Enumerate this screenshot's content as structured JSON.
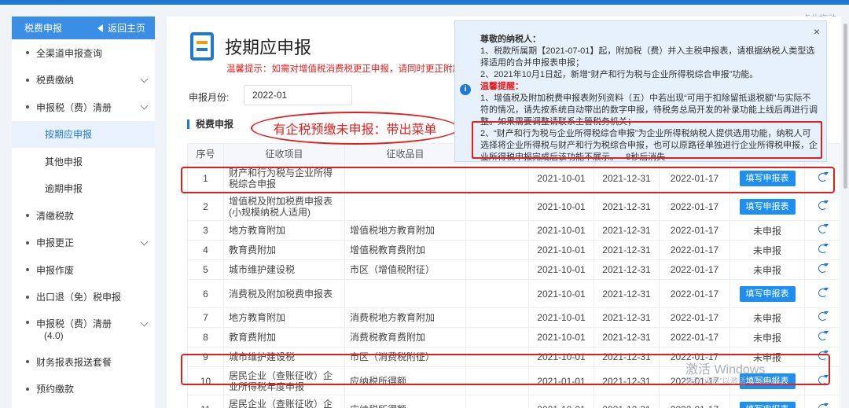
{
  "sidebar": {
    "title": "税费申报",
    "back_label": "返回主页",
    "items": [
      {
        "label": "全渠道申报查询",
        "expandable": false
      },
      {
        "label": "税费缴纳",
        "expandable": true
      },
      {
        "label": "申报税（费）清册",
        "expandable": true
      },
      {
        "label": "按期应申报",
        "sub": true,
        "active": true
      },
      {
        "label": "其他申报",
        "sub": true
      },
      {
        "label": "逾期申报",
        "sub": true
      },
      {
        "label": "清缴税款",
        "expandable": false
      },
      {
        "label": "申报更正",
        "expandable": true
      },
      {
        "label": "申报作废",
        "expandable": false
      },
      {
        "label": "出口退（免）税申报",
        "expandable": false
      },
      {
        "label": "申报税（费）清册",
        "label2": "(4.0)",
        "expandable": true
      },
      {
        "label": "财务报表报送套餐",
        "expandable": false
      },
      {
        "label": "预约缴款",
        "expandable": false
      }
    ]
  },
  "main": {
    "title": "按期应申报",
    "warm_tip": "温馨提示：如需对增值税消费税更正申报，请同时更正附加",
    "month_label": "申报月份:",
    "month_value": "2022-01",
    "section_label": "税费申报",
    "annotation": "有企税预缴未申报：带出菜单"
  },
  "table": {
    "headers": [
      "序号",
      "征收项目",
      "征收品目",
      "",
      "",
      "",
      "",
      "",
      ""
    ],
    "fill_label": "填写申报表",
    "unfiled_label": "未申报",
    "rows": [
      {
        "no": "1",
        "item": "财产和行为税与企业所得税综合申报",
        "sub": "",
        "start": "2021-10-01",
        "end": "2021-12-31",
        "due": "2022-01-17",
        "status": "fill",
        "tall": true
      },
      {
        "no": "2",
        "item": "增值税及附加税费申报表(小规模纳税人适用)",
        "sub": "",
        "start": "2021-10-01",
        "end": "2021-12-31",
        "due": "2022-01-17",
        "status": "fill",
        "tall": true
      },
      {
        "no": "3",
        "item": "地方教育附加",
        "sub": "增值税地方教育附加",
        "start": "2021-10-01",
        "end": "2021-12-31",
        "due": "2022-01-17",
        "status": "unfiled"
      },
      {
        "no": "4",
        "item": "教育费附加",
        "sub": "增值税教育费附加",
        "start": "2021-10-01",
        "end": "2021-12-31",
        "due": "2022-01-17",
        "status": "unfiled"
      },
      {
        "no": "5",
        "item": "城市维护建设税",
        "sub": "市区（增值税附征）",
        "start": "2021-10-01",
        "end": "2021-12-31",
        "due": "2022-01-17",
        "status": "unfiled"
      },
      {
        "no": "6",
        "item": "消费税及附加税费申报表",
        "sub": "",
        "start": "2021-10-01",
        "end": "2021-12-31",
        "due": "2022-01-17",
        "status": "fill",
        "tall": true
      },
      {
        "no": "7",
        "item": "地方教育附加",
        "sub": "消费税地方教育附加",
        "start": "2021-10-01",
        "end": "2021-12-31",
        "due": "2022-01-17",
        "status": "unfiled"
      },
      {
        "no": "8",
        "item": "教育费附加",
        "sub": "消费税教育费附加",
        "start": "2021-10-01",
        "end": "2021-12-31",
        "due": "2022-01-17",
        "status": "unfiled"
      },
      {
        "no": "9",
        "item": "城市维护建设税",
        "sub": "市区（消费税附征）",
        "start": "2021-10-01",
        "end": "2021-12-31",
        "due": "2022-01-17",
        "status": "unfiled"
      },
      {
        "no": "10",
        "item": "居民企业（查账征收）企业所得税年度申报",
        "sub": "应纳税所得额",
        "start": "2021-01-01",
        "end": "2021-12-31",
        "due": "2022-01-17",
        "status": "fill",
        "tall": true
      },
      {
        "no": "11",
        "item": "居民企业（查账征收）企业所得税月（季）度申报",
        "sub": "应纳税所得额",
        "start": "2021-10-01",
        "end": "2021-12-31",
        "due": "2022-01-17",
        "status": "fill",
        "tall": true
      }
    ]
  },
  "notice": {
    "greeting": "尊敬的纳税人：",
    "line1": "1、税款所属期【2021-07-01】起，附加税（费）并入主税申报表，请根据纳税人类型选择适用的合并申报表申报；",
    "line2": "2、2021年10月1日起，新增“财产和行为税与企业所得税综合申报”功能。",
    "warm_title": "温馨提醒：",
    "tip1": "1、增值税及附加税费申报表附列资料（五）中若出现“可用于扣除留抵退税额”与实际不符的情况，请先按系统自动带出的数字申报，待税务总局开发的补录功能上线后再进行调整。如果需要调整请联系主管税务机关；",
    "tip2": "2、“财产和行为税与企业所得税综合申报”为企业所得税纳税人提供选用功能，纳税人可选择将企业所得税与财产和行为税综合申报，也可以原路径单独进行企业所得税申报，企业所得税申报完成后该功能不展示。",
    "countdown": "8秒后消失",
    "close": "×",
    "info": "i"
  },
  "drag_hint": "点此拖动",
  "watermark": "激活 Windows",
  "watermark_sub": "转到“设置”以激活 Windows。"
}
